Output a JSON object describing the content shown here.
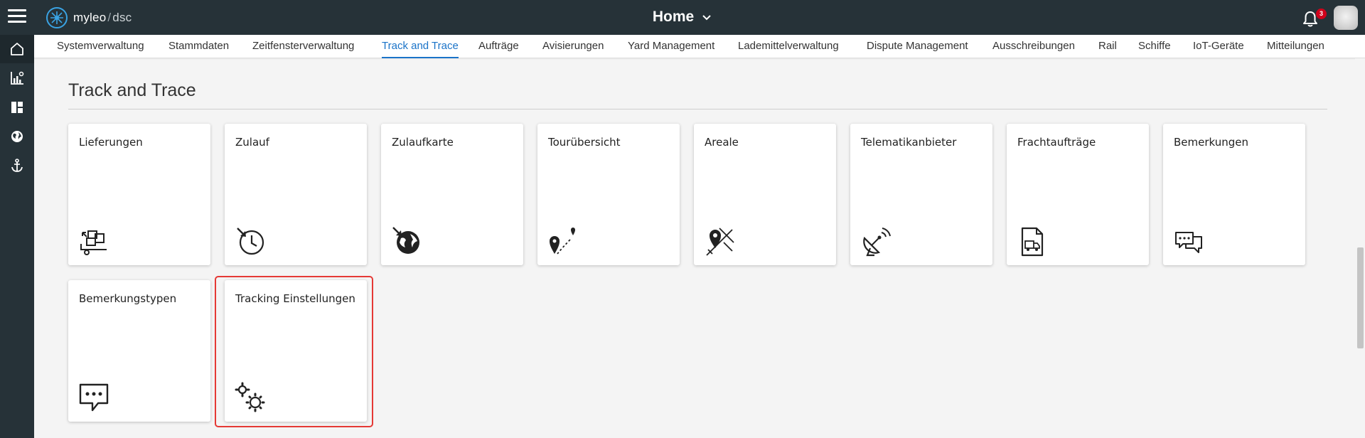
{
  "header": {
    "logo_name": "myleo",
    "logo_sep": "/",
    "logo_suffix": "dsc",
    "title": "Home",
    "notification_count": "3"
  },
  "rail": {
    "items": [
      "home-icon",
      "chart-icon",
      "dashboard-icon",
      "globe-icon",
      "anchor-icon"
    ]
  },
  "tabs": [
    {
      "label": "Systemverwaltung"
    },
    {
      "label": "Stammdaten"
    },
    {
      "label": "Zeitfensterverwaltung"
    },
    {
      "label": "Track and Trace"
    },
    {
      "label": "Aufträge"
    },
    {
      "label": "Avisierungen"
    },
    {
      "label": "Yard Management"
    },
    {
      "label": "Lademittelverwaltung"
    },
    {
      "label": "Dispute Management"
    },
    {
      "label": "Ausschreibungen"
    },
    {
      "label": "Rail"
    },
    {
      "label": "Schiffe"
    },
    {
      "label": "IoT-Geräte"
    },
    {
      "label": "Mitteilungen"
    }
  ],
  "active_tab": "Track and Trace",
  "section": {
    "title": "Track and Trace"
  },
  "cards": [
    {
      "label": "Lieferungen",
      "icon": "delivery-icon"
    },
    {
      "label": "Zulauf",
      "icon": "clock-arrow-icon"
    },
    {
      "label": "Zulaufkarte",
      "icon": "globe-arrow-icon"
    },
    {
      "label": "Tourübersicht",
      "icon": "route-pin-icon"
    },
    {
      "label": "Areale",
      "icon": "area-map-icon"
    },
    {
      "label": "Telematikanbieter",
      "icon": "satellite-dish-icon"
    },
    {
      "label": "Frachtaufträge",
      "icon": "truck-document-icon"
    },
    {
      "label": "Bemerkungen",
      "icon": "comments-icon"
    },
    {
      "label": "Bemerkungstypen",
      "icon": "comment-dots-icon"
    },
    {
      "label": "Tracking Einstellungen",
      "icon": "gears-icon"
    }
  ],
  "colors": {
    "topbar": "#263238",
    "accent": "#1a73c8",
    "badge": "#d0021b",
    "highlight": "#e53935"
  }
}
